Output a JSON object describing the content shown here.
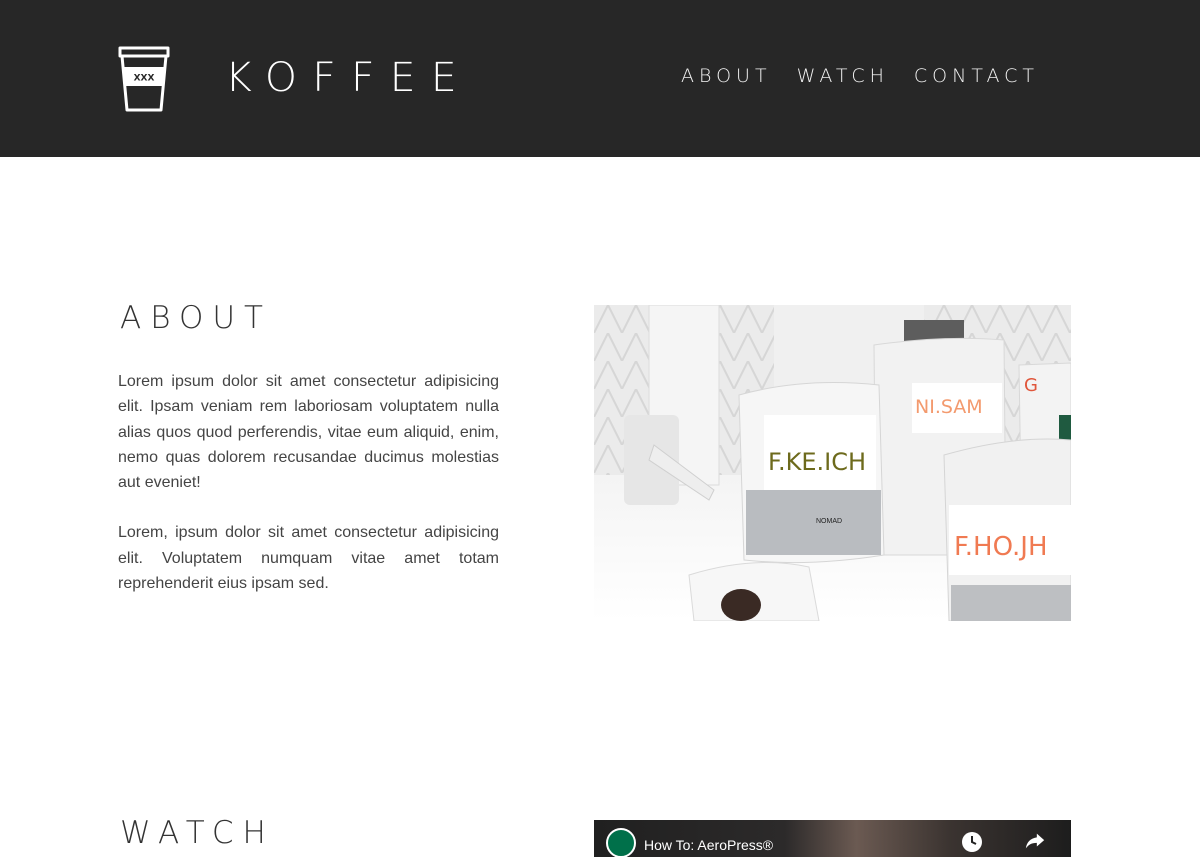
{
  "header": {
    "brand": "KOFFEE",
    "logo_text": "XXX",
    "nav": [
      "ABOUT",
      "WATCH",
      "CONTACT"
    ]
  },
  "about": {
    "title": "ABOUT",
    "paragraphs": [
      "Lorem ipsum dolor sit amet consectetur adipisicing elit. Ipsam veniam rem laboriosam voluptatem nulla alias quos quod perferendis, vitae eum aliquid, enim, nemo quas dolorem recusandae ducimus molestias aut eveniet!",
      "Lorem, ipsum dolor sit amet consectetur adipisicing elit. Voluptatem numquam vitae amet totam reprehenderit eius ipsam sed."
    ],
    "image": {
      "bag_labels": [
        "F.KE.ICH",
        "NI.SAM",
        "F.HO.JH",
        "G"
      ],
      "bag_brand": "NOMAD"
    }
  },
  "watch": {
    "title": "WATCH",
    "video_title": "How To: AeroPress®"
  },
  "colors": {
    "header_bg": "#272727",
    "header_text": "#ffffff",
    "body_bg": "#ffffff",
    "text": "#444444",
    "label_olive": "#6d6a1c",
    "label_orange": "#f39a6e",
    "label_red": "#e0563b",
    "video_badge": "#00704a"
  }
}
